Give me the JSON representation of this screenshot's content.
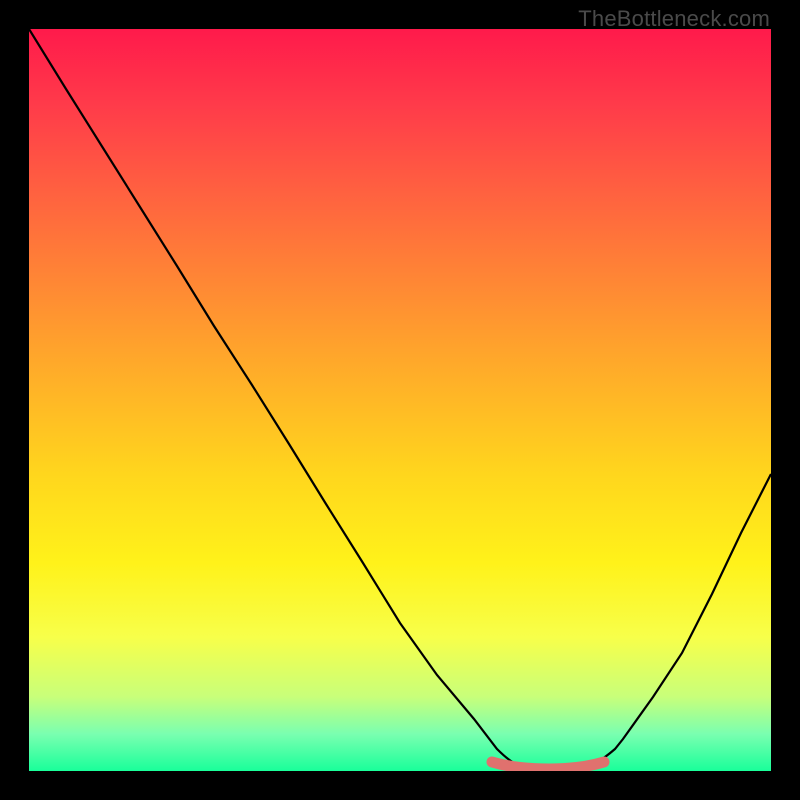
{
  "credit_text": "TheBottleneck.com",
  "chart_data": {
    "type": "line",
    "title": "",
    "xlabel": "",
    "ylabel": "",
    "xlim": [
      0,
      100
    ],
    "ylim": [
      0,
      100
    ],
    "series": [
      {
        "name": "bottleneck-curve",
        "x": [
          0,
          5,
          10,
          15,
          20,
          25,
          30,
          35,
          40,
          45,
          50,
          55,
          60,
          63,
          66,
          70,
          74,
          77,
          80,
          84,
          88,
          92,
          96,
          100
        ],
        "y": [
          100,
          92,
          84,
          76,
          68,
          60,
          52,
          44,
          36,
          28,
          20,
          13,
          7,
          3,
          1,
          0,
          0,
          0,
          2,
          6,
          12,
          20,
          28,
          36
        ]
      },
      {
        "name": "flat-highlight",
        "x": [
          63,
          77
        ],
        "y": [
          0.5,
          0.5
        ]
      }
    ],
    "highlight_color": "#e0716e",
    "curve_color": "#000000"
  }
}
